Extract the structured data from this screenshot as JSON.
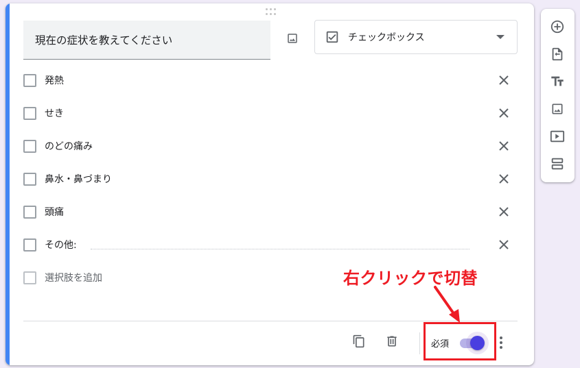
{
  "question": {
    "title": "現在の症状を教えてください",
    "type_label": "チェックボックス"
  },
  "options": [
    {
      "label": "発熱"
    },
    {
      "label": "せき"
    },
    {
      "label": "のどの痛み"
    },
    {
      "label": "鼻水・鼻づまり"
    },
    {
      "label": "頭痛"
    }
  ],
  "other_option": {
    "label": "その他:"
  },
  "add_option": {
    "label": "選択肢を追加"
  },
  "footer": {
    "required_label": "必須",
    "required_on": true
  },
  "annotation": {
    "text": "右クリックで切替"
  },
  "colors": {
    "accent": "#4285f4",
    "toggle": "#4a3fe0",
    "annotation": "#ee1c24"
  },
  "icons": {
    "title_image": "image-icon",
    "type": "checkbox-checked-icon",
    "dropdown": "caret-down-icon",
    "remove": "close-icon",
    "duplicate": "copy-icon",
    "delete": "trash-icon",
    "more": "more-vert-icon",
    "toolbar": [
      "add-circle-icon",
      "import-icon",
      "title-icon",
      "image-icon",
      "video-icon",
      "section-icon"
    ]
  }
}
